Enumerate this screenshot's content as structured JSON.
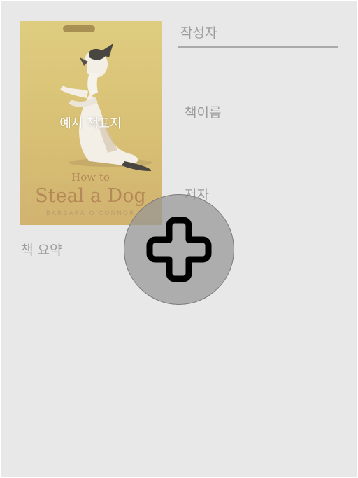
{
  "cover": {
    "caption": "예시 책표지",
    "title_small": "How to",
    "title_big": "Steal a Dog",
    "author": "BARBARA O'CONNOR"
  },
  "form": {
    "writer_placeholder": "작성자",
    "book_name_label": "책이름",
    "author_label": "저자",
    "summary_label": "책 요약"
  },
  "fab": {
    "icon": "plus-icon",
    "color": "#969696"
  }
}
